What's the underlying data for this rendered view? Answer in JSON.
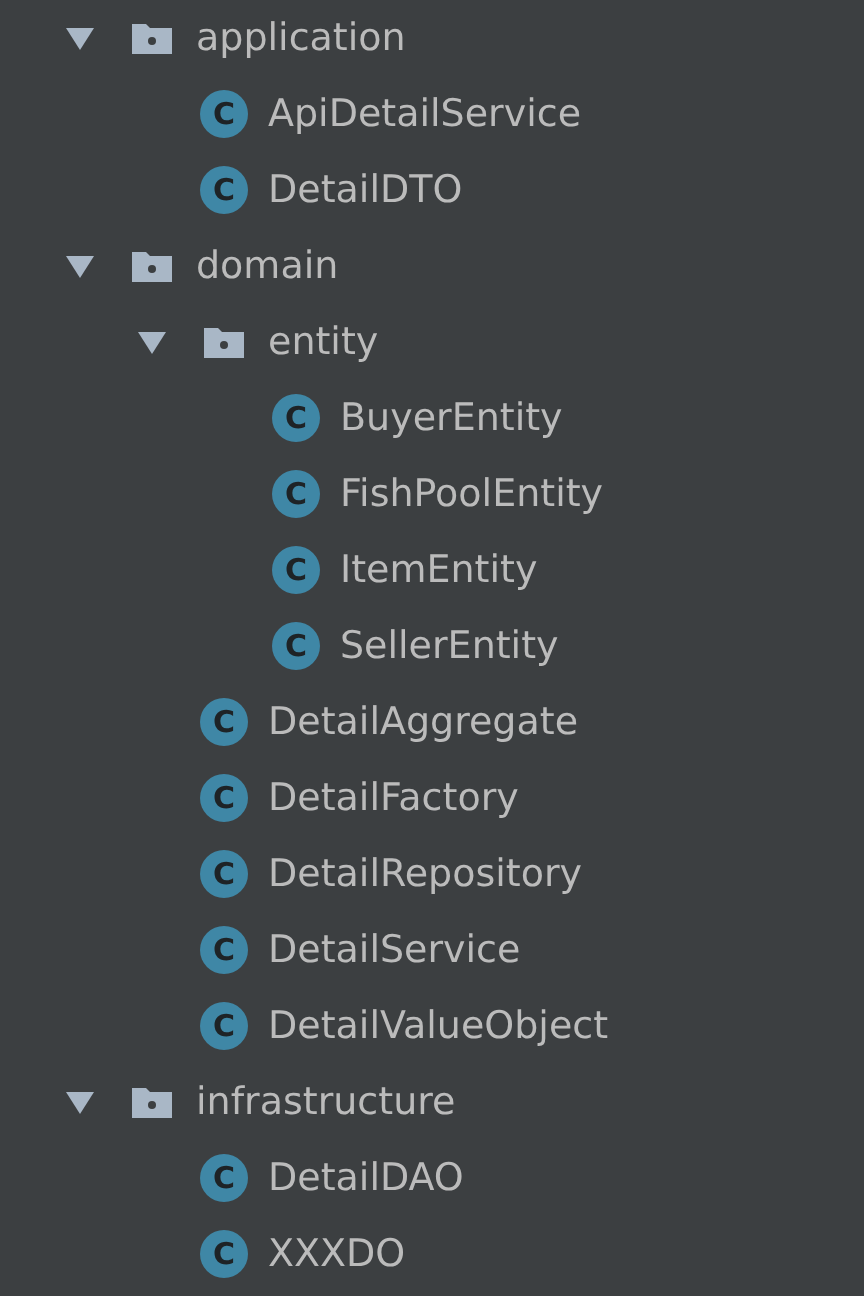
{
  "tree": [
    {
      "kind": "folder",
      "label": "application",
      "expanded": true,
      "children": [
        {
          "kind": "class",
          "badge": "C",
          "label": "ApiDetailService"
        },
        {
          "kind": "class",
          "badge": "C",
          "label": "DetailDTO"
        }
      ]
    },
    {
      "kind": "folder",
      "label": "domain",
      "expanded": true,
      "children": [
        {
          "kind": "folder",
          "label": "entity",
          "expanded": true,
          "children": [
            {
              "kind": "class",
              "badge": "C",
              "label": "BuyerEntity"
            },
            {
              "kind": "class",
              "badge": "C",
              "label": "FishPoolEntity"
            },
            {
              "kind": "class",
              "badge": "C",
              "label": "ItemEntity"
            },
            {
              "kind": "class",
              "badge": "C",
              "label": "SellerEntity"
            }
          ]
        },
        {
          "kind": "class",
          "badge": "C",
          "label": "DetailAggregate"
        },
        {
          "kind": "class",
          "badge": "C",
          "label": "DetailFactory"
        },
        {
          "kind": "class",
          "badge": "C",
          "label": "DetailRepository"
        },
        {
          "kind": "class",
          "badge": "C",
          "label": "DetailService"
        },
        {
          "kind": "class",
          "badge": "C",
          "label": "DetailValueObject"
        }
      ]
    },
    {
      "kind": "folder",
      "label": "infrastructure",
      "expanded": true,
      "children": [
        {
          "kind": "class",
          "badge": "C",
          "label": "DetailDAO"
        },
        {
          "kind": "class",
          "badge": "C",
          "label": "XXXDO"
        }
      ]
    }
  ]
}
